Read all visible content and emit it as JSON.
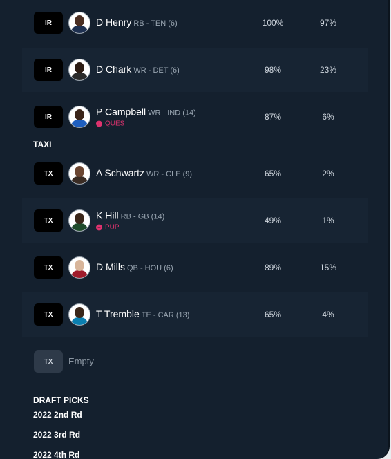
{
  "ir_players": [
    {
      "slot": "IR",
      "name": "D Henry",
      "meta": "RB - TEN (6)",
      "status": "",
      "pct1": "100%",
      "pct2": "97%",
      "skin": "#4a2e22",
      "jersey": "#1e3050"
    },
    {
      "slot": "IR",
      "name": "D Chark",
      "meta": "WR - DET (6)",
      "status": "",
      "pct1": "98%",
      "pct2": "23%",
      "skin": "#2c1c14",
      "jersey": "#2a2a2a"
    },
    {
      "slot": "IR",
      "name": "P Campbell",
      "meta": "WR - IND (14)",
      "status": "QUES",
      "status_icon": "!",
      "pct1": "87%",
      "pct2": "6%",
      "skin": "#3b2519",
      "jersey": "#1f5fbf"
    }
  ],
  "taxi_label": "TAXI",
  "taxi_players": [
    {
      "slot": "TX",
      "name": "A Schwartz",
      "meta": "WR - CLE (9)",
      "status": "",
      "pct1": "65%",
      "pct2": "2%",
      "skin": "#6b4632",
      "jersey": "#3a2c24"
    },
    {
      "slot": "TX",
      "name": "K Hill",
      "meta": "RB - GB (14)",
      "status": "PUP",
      "status_icon": "–",
      "pct1": "49%",
      "pct2": "1%",
      "skin": "#3a2619",
      "jersey": "#1f4a2a"
    },
    {
      "slot": "TX",
      "name": "D Mills",
      "meta": "QB - HOU (6)",
      "status": "",
      "pct1": "89%",
      "pct2": "15%",
      "skin": "#d8b59a",
      "jersey": "#a01c2c"
    },
    {
      "slot": "TX",
      "name": "T Tremble",
      "meta": "TE - CAR (13)",
      "status": "",
      "pct1": "65%",
      "pct2": "4%",
      "skin": "#3a2619",
      "jersey": "#0b7fb0"
    }
  ],
  "empty_slot": {
    "slot": "TX",
    "label": "Empty"
  },
  "draft_label": "DRAFT PICKS",
  "picks": [
    "2022 2nd Rd",
    "2022 3rd Rd",
    "2022 4th Rd"
  ]
}
